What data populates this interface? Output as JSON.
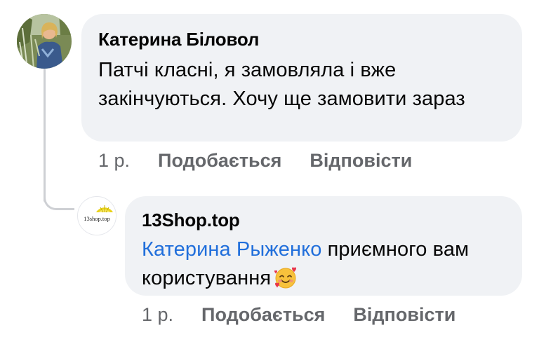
{
  "comments": [
    {
      "author": "Катерина Біловол",
      "text": "Патчі класні, я замовляла і вже закінчуються. Хочу ще замовити зараз",
      "time": "1 р.",
      "like_label": "Подобається",
      "reply_label": "Відповісти",
      "avatar_icon": "user-photo-avatar"
    },
    {
      "author": "13Shop.top",
      "mention": "Катерина Рыженко",
      "text": " приємного вам користування",
      "emoji": "smiling-face-with-hearts",
      "time": "1 р.",
      "like_label": "Подобається",
      "reply_label": "Відповісти",
      "avatar_icon": "13shop-logo-avatar",
      "avatar_text": "13shop.top"
    }
  ],
  "colors": {
    "bubble": "#f0f2f5",
    "mention": "#216fdb",
    "meta": "#65676b",
    "thread_line": "#ced0d4"
  }
}
